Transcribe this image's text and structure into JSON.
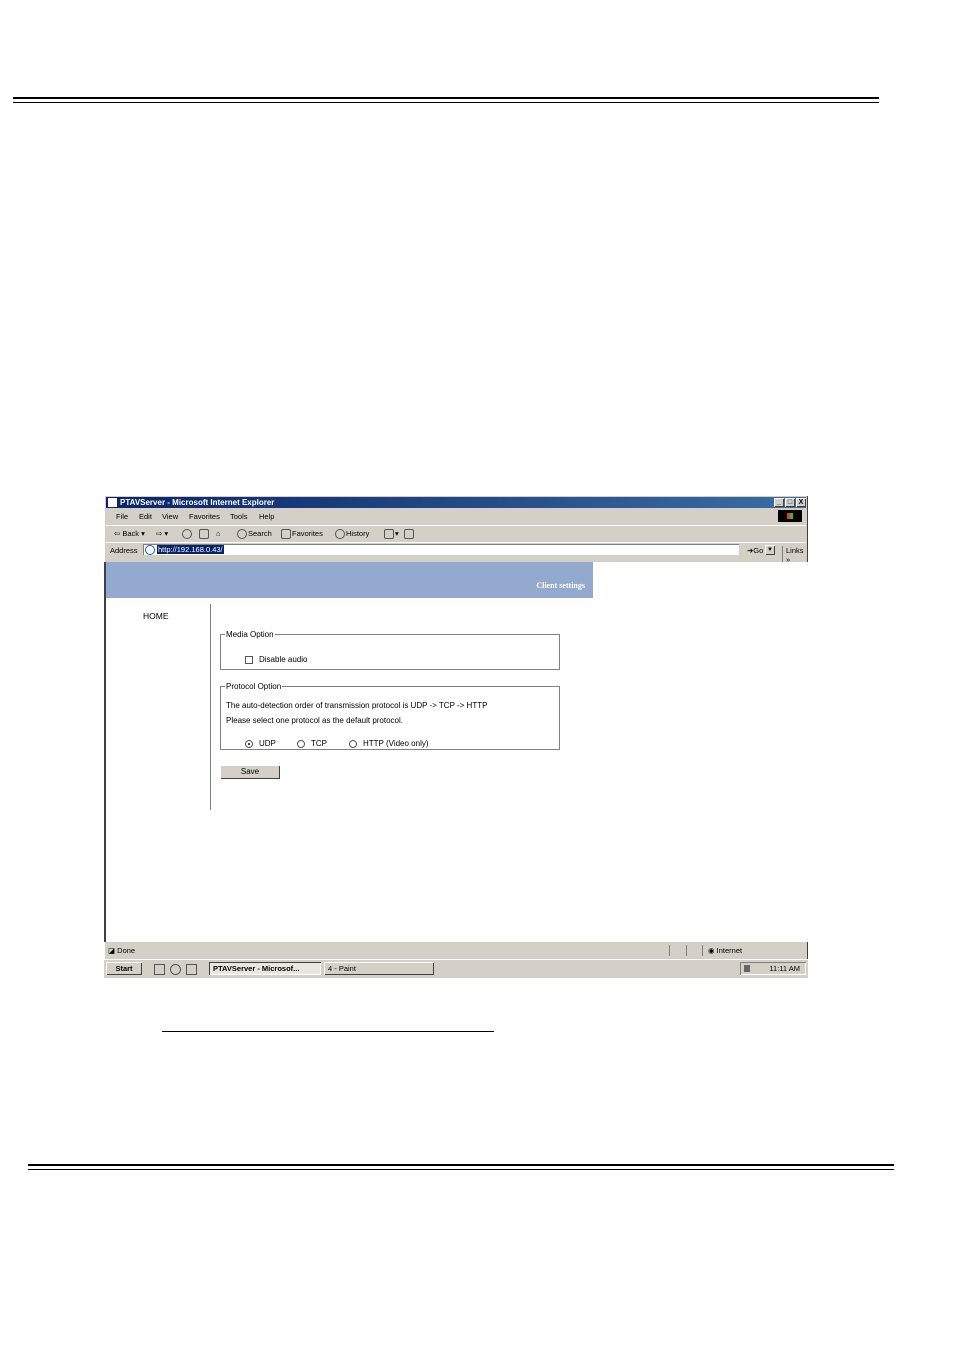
{
  "browser": {
    "title": "PTAVServer - Microsoft Internet Explorer",
    "window_buttons": [
      "_",
      "□",
      "X"
    ],
    "menu": [
      "File",
      "Edit",
      "View",
      "Favorites",
      "Tools",
      "Help"
    ],
    "toolbar": {
      "back": "Back",
      "search": "Search",
      "favorites": "Favorites",
      "history": "History"
    },
    "address_label": "Address",
    "address_value": "http://192.168.0.43/",
    "go_label": "Go",
    "links_label": "Links"
  },
  "page": {
    "banner_title": "Client settings",
    "nav_home": "HOME",
    "media_option": {
      "legend": "Media Option",
      "disable_audio_label": "Disable audio",
      "disable_audio_checked": false
    },
    "protocol_option": {
      "legend": "Protocol Option",
      "line1": "The auto-detection order of transmission protocol is UDP -> TCP -> HTTP",
      "line2": "Please select one protocol as the default protocol.",
      "options": [
        "UDP",
        "TCP",
        "HTTP (Video only)"
      ],
      "selected": "UDP"
    },
    "save_label": "Save"
  },
  "status": {
    "text": "Done",
    "zone": "Internet"
  },
  "taskbar": {
    "start_label": "Start",
    "tasks": [
      "PTAVServer - Microsof...",
      "4 - Paint"
    ],
    "clock": "11:11 AM"
  }
}
